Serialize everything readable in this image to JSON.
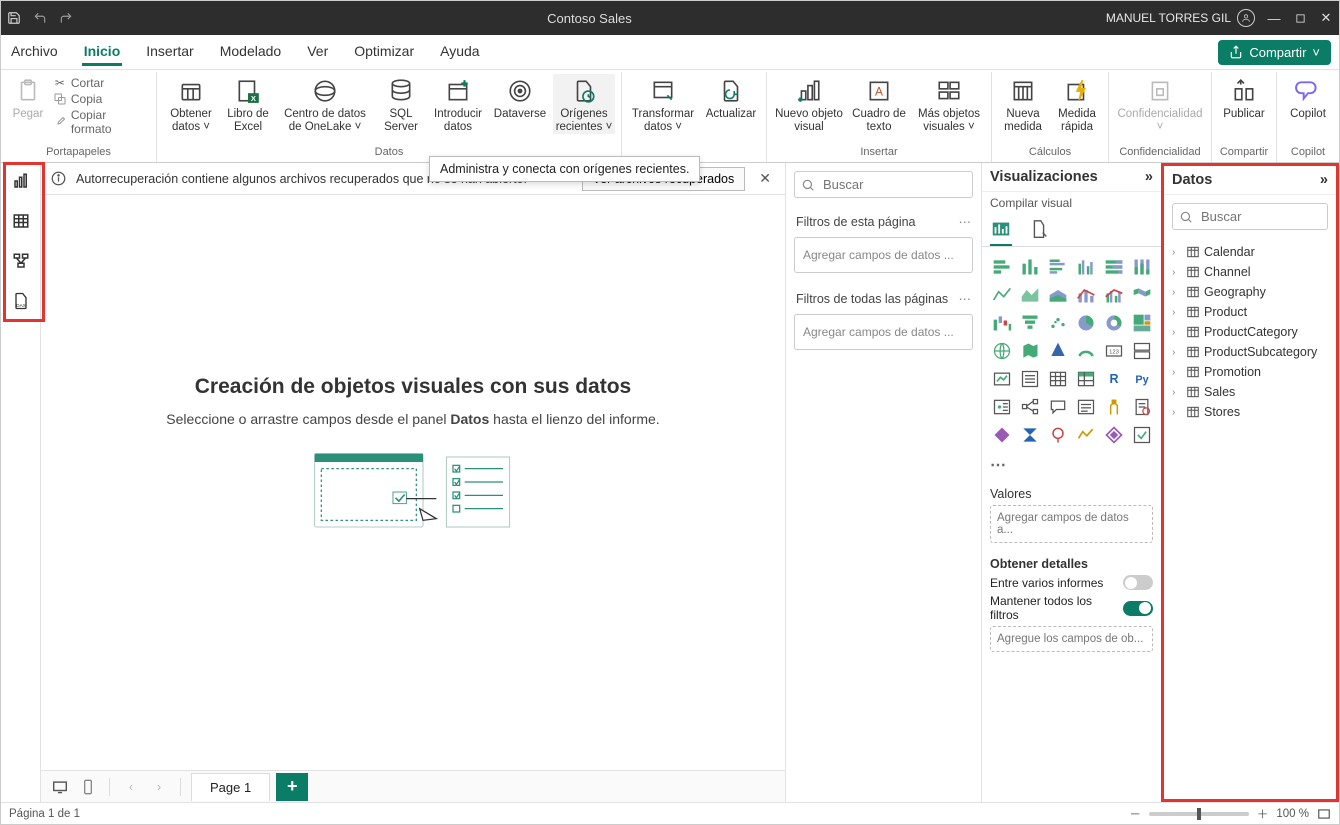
{
  "titlebar": {
    "title": "Contoso Sales",
    "user": "MANUEL TORRES GIL"
  },
  "menu": {
    "items": [
      "Archivo",
      "Inicio",
      "Insertar",
      "Modelado",
      "Ver",
      "Optimizar",
      "Ayuda"
    ],
    "active_index": 1,
    "share_label": "Compartir"
  },
  "ribbon": {
    "clipboard": {
      "paste": "Pegar",
      "cut": "Cortar",
      "copy": "Copia",
      "format_painter": "Copiar formato",
      "caption": "Portapapeles"
    },
    "data": {
      "get_data": "Obtener datos",
      "excel": "Libro de Excel",
      "onelake": "Centro de datos de OneLake",
      "sql": "SQL Server",
      "enter_data": "Introducir datos",
      "dataverse": "Dataverse",
      "recent": "Orígenes recientes",
      "caption": "Datos",
      "tooltip": "Administra y conecta con orígenes recientes."
    },
    "queries": {
      "transform": "Transformar datos",
      "refresh": "Actualizar"
    },
    "insert": {
      "visual": "Nuevo objeto visual",
      "textbox": "Cuadro de texto",
      "more": "Más objetos visuales",
      "caption": "Insertar"
    },
    "calc": {
      "measure": "Nueva medida",
      "quick": "Medida rápida",
      "caption": "Cálculos"
    },
    "sensitivity": {
      "label": "Confidencialidad",
      "caption": "Confidencialidad"
    },
    "publish": {
      "label": "Publicar",
      "caption": "Compartir"
    },
    "copilot": {
      "label": "Copilot",
      "caption": "Copilot"
    }
  },
  "infobar": {
    "message": "Autorrecuperación contiene algunos archivos recuperados que no se han abierto.",
    "button": "Ver archivos recuperados"
  },
  "canvas": {
    "title": "Creación de objetos visuales con sus datos",
    "subtitle_pre": "Seleccione o arrastre campos desde el panel ",
    "subtitle_bold": "Datos",
    "subtitle_post": " hasta el lienzo del informe."
  },
  "pages": {
    "tab1": "Page 1"
  },
  "statusbar": {
    "page_text": "Página 1 de 1",
    "zoom": "100 %"
  },
  "filters": {
    "search_placeholder": "Buscar",
    "page_filters": "Filtros de esta página",
    "all_pages_filters": "Filtros de todas las páginas",
    "add_fields": "Agregar campos de datos ..."
  },
  "viz": {
    "header": "Visualizaciones",
    "sub": "Compilar visual",
    "values": "Valores",
    "add_fields": "Agregar campos de datos a...",
    "drill": "Obtener detalles",
    "cross_report": "Entre varios informes",
    "keep_filters": "Mantener todos los filtros",
    "drill_fields": "Agregue los campos de ob..."
  },
  "data_panel": {
    "header": "Datos",
    "search_placeholder": "Buscar",
    "tables": [
      "Calendar",
      "Channel",
      "Geography",
      "Product",
      "ProductCategory",
      "ProductSubcategory",
      "Promotion",
      "Sales",
      "Stores"
    ]
  }
}
